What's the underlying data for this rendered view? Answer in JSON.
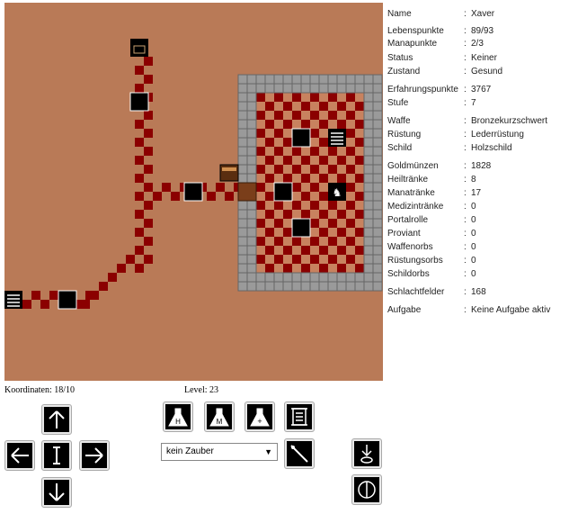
{
  "stats": [
    {
      "label": "Name",
      "value": "Xaver"
    },
    {
      "label": "Lebenspunkte",
      "value": "89/93"
    },
    {
      "label": "Manapunkte",
      "value": "2/3"
    },
    {
      "label": "Status",
      "value": "Keiner"
    },
    {
      "label": "Zustand",
      "value": "Gesund"
    },
    {
      "label": "Erfahrungspunkte",
      "value": "3767"
    },
    {
      "label": "Stufe",
      "value": "7"
    },
    {
      "label": "Waffe",
      "value": "Bronzekurzschwert"
    },
    {
      "label": "Rüstung",
      "value": "Lederrüstung"
    },
    {
      "label": "Schild",
      "value": "Holzschild"
    },
    {
      "label": "Goldmünzen",
      "value": "1828"
    },
    {
      "label": "Heiltränke",
      "value": "8"
    },
    {
      "label": "Manatränke",
      "value": "17"
    },
    {
      "label": "Medizintränke",
      "value": "0"
    },
    {
      "label": "Portalrolle",
      "value": "0"
    },
    {
      "label": "Proviant",
      "value": "0"
    },
    {
      "label": "Waffenorbs",
      "value": "0"
    },
    {
      "label": "Rüstungsorbs",
      "value": "0"
    },
    {
      "label": "Schildorbs",
      "value": "0"
    },
    {
      "label": "Schlachtfelder",
      "value": "168"
    },
    {
      "label": "Aufgabe",
      "value": "Keine Aufgabe aktiv"
    }
  ],
  "separator": ":",
  "footer": {
    "coords": "Koordinaten: 18/10",
    "level": "Level: 23"
  },
  "potions": {
    "heal_letter": "H",
    "mana_letter": "M",
    "medicine_letter": "+"
  },
  "spell_select": {
    "value": "kein Zauber"
  },
  "colors": {
    "ground": "#b97a57",
    "path_dark": "#8b0000",
    "checker_light": "#c8825f",
    "wall": "#9a9a9a"
  }
}
